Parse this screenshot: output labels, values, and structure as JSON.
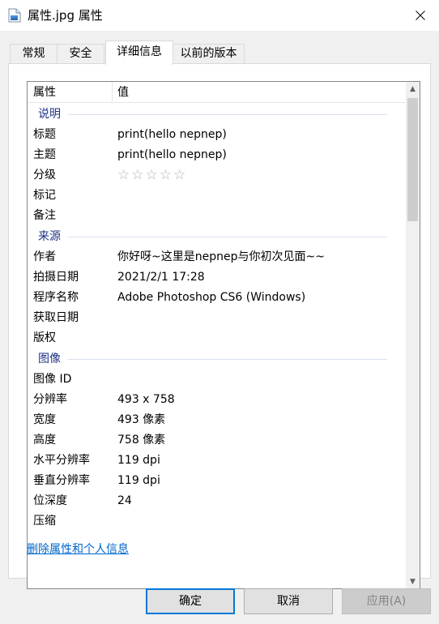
{
  "window": {
    "title": "属性.jpg 属性",
    "icon": "file-icon"
  },
  "tabs": [
    {
      "label": "常规",
      "active": false
    },
    {
      "label": "安全",
      "active": false
    },
    {
      "label": "详细信息",
      "active": true
    },
    {
      "label": "以前的版本",
      "active": false
    }
  ],
  "list": {
    "header": {
      "col1": "属性",
      "col2": "值"
    },
    "groups": [
      {
        "name": "说明",
        "rows": [
          {
            "key": "标题",
            "value": "print(hello nepnep)"
          },
          {
            "key": "主题",
            "value": "print(hello nepnep)"
          },
          {
            "key": "分级",
            "value": "",
            "stars": 0
          },
          {
            "key": "标记",
            "value": ""
          },
          {
            "key": "备注",
            "value": ""
          }
        ]
      },
      {
        "name": "来源",
        "rows": [
          {
            "key": "作者",
            "value": "你好呀~这里是nepnep与你初次见面~~"
          },
          {
            "key": "拍摄日期",
            "value": "2021/2/1 17:28"
          },
          {
            "key": "程序名称",
            "value": "Adobe Photoshop CS6 (Windows)"
          },
          {
            "key": "获取日期",
            "value": ""
          },
          {
            "key": "版权",
            "value": ""
          }
        ]
      },
      {
        "name": "图像",
        "rows": [
          {
            "key": "图像 ID",
            "value": ""
          },
          {
            "key": "分辨率",
            "value": "493 x 758"
          },
          {
            "key": "宽度",
            "value": "493 像素"
          },
          {
            "key": "高度",
            "value": "758 像素"
          },
          {
            "key": "水平分辨率",
            "value": "119 dpi"
          },
          {
            "key": "垂直分辨率",
            "value": "119 dpi"
          },
          {
            "key": "位深度",
            "value": "24"
          },
          {
            "key": "压缩",
            "value": ""
          }
        ]
      }
    ]
  },
  "link": {
    "label": "删除属性和个人信息"
  },
  "buttons": {
    "ok": "确定",
    "cancel": "取消",
    "apply": "应用(A)"
  },
  "colors": {
    "accent": "#0078d7",
    "group": "#1e3287",
    "link": "#0066cc"
  }
}
